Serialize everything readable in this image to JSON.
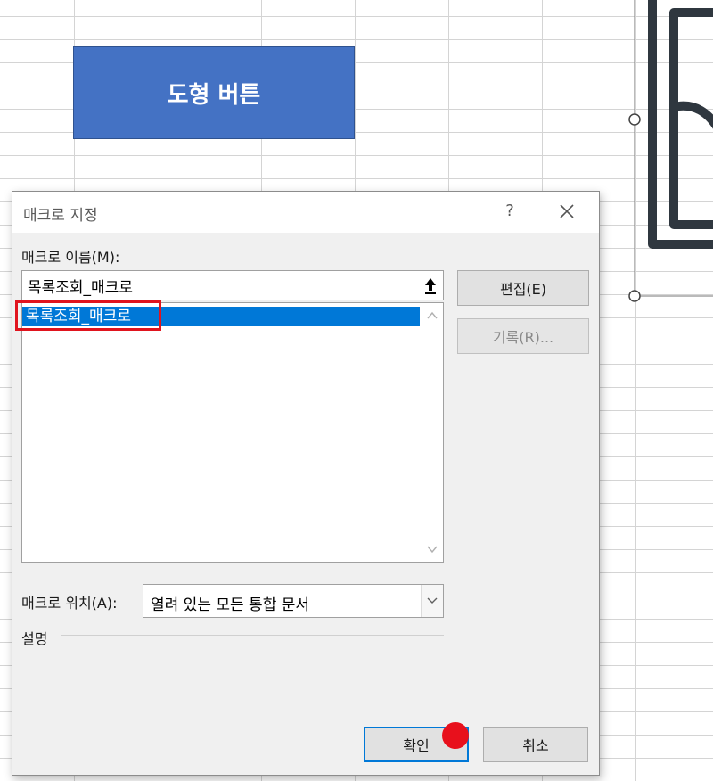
{
  "sheet": {
    "shape_button_label": "도형 버튼"
  },
  "dialog": {
    "title": "매크로 지정",
    "help_label": "?",
    "macro_name_label": "매크로 이름(M):",
    "macro_name_value": "목록조회_매크로",
    "macro_list": [
      "목록조회_매크로"
    ],
    "edit_button": "편집(E)",
    "record_button": "기록(R)...",
    "location_label": "매크로 위치(A):",
    "location_value": "열려 있는 모든 통합 문서",
    "description_label": "설명",
    "ok_button": "확인",
    "cancel_button": "취소"
  },
  "colors": {
    "shape_fill": "#4472c4",
    "selection": "#0078d7",
    "highlight": "#e0141e",
    "cursor_marker": "#e8101c"
  }
}
